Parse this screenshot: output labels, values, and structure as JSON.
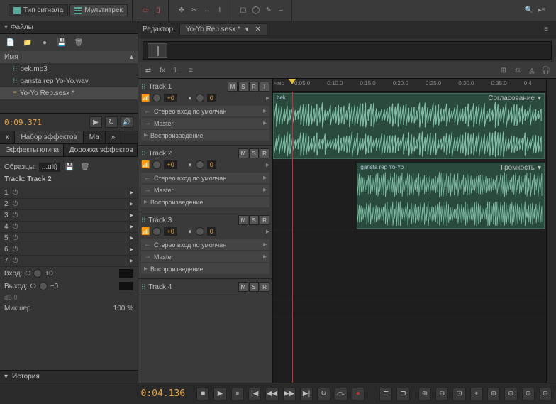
{
  "toolbar": {
    "signal_view": "Тип сигнала",
    "multitrack_view": "Мультитрек"
  },
  "files_panel": {
    "title": "Файлы",
    "name_header": "Имя",
    "items": [
      {
        "name": "bek.mp3",
        "type": "wave"
      },
      {
        "name": "gansta rep Yo-Yo.wav",
        "type": "wave"
      },
      {
        "name": "Yo-Yo Rep.sesx *",
        "type": "session",
        "selected": true
      }
    ],
    "time": "0:09.371"
  },
  "tabs_left": {
    "short": "к",
    "effects": "Набор эффектов",
    "m": "Ма"
  },
  "fx": {
    "tab_clip": "Эффекты клипа",
    "tab_track": "Дорожка эффектов",
    "samples_lbl": "Образцы:",
    "samples_val": "...ult)",
    "track_lbl": "Track: Track 2",
    "slots": [
      "1",
      "2",
      "3",
      "4",
      "5",
      "6",
      "7"
    ],
    "input_lbl": "Вход:",
    "output_lbl": "Выход:",
    "io_val": "+0",
    "db_lbl": "dB   0",
    "mixer_lbl": "Микшер",
    "mixer_val": "100 %"
  },
  "history_title": "История",
  "editor": {
    "title_prefix": "Редактор:",
    "session_name": "Yo-Yo Rep.sesx *"
  },
  "ruler": {
    "unit": "чмс",
    "ticks": [
      "0:05.0",
      "0:10.0",
      "0:15.0",
      "0:20.0",
      "0:25.0",
      "0:30.0",
      "0:35.0",
      "0:4"
    ]
  },
  "tracks": [
    {
      "name": "Track 1",
      "vol": "+0",
      "pan": "0",
      "input": "Стерео вход по умолчан",
      "output": "Master",
      "read": "Воспроизведение",
      "clip": {
        "label": "bek",
        "match": "Согласование",
        "start": 0,
        "end": 1
      }
    },
    {
      "name": "Track 2",
      "vol": "+0",
      "pan": "0",
      "input": "Стерео вход по умолчан",
      "output": "Master",
      "read": "Воспроизведение",
      "clip": {
        "label": "gansta rep Yo-Yo",
        "vol_lbl": "Громкость",
        "start": 0.32,
        "end": 1
      }
    },
    {
      "name": "Track 3",
      "vol": "+0",
      "pan": "0",
      "input": "Стерео вход по умолчан",
      "output": "Master",
      "read": "Воспроизведение"
    },
    {
      "name": "Track 4"
    }
  ],
  "msr": {
    "m": "M",
    "s": "S",
    "r": "R",
    "i": "I"
  },
  "transport": {
    "time": "0:04.136"
  }
}
